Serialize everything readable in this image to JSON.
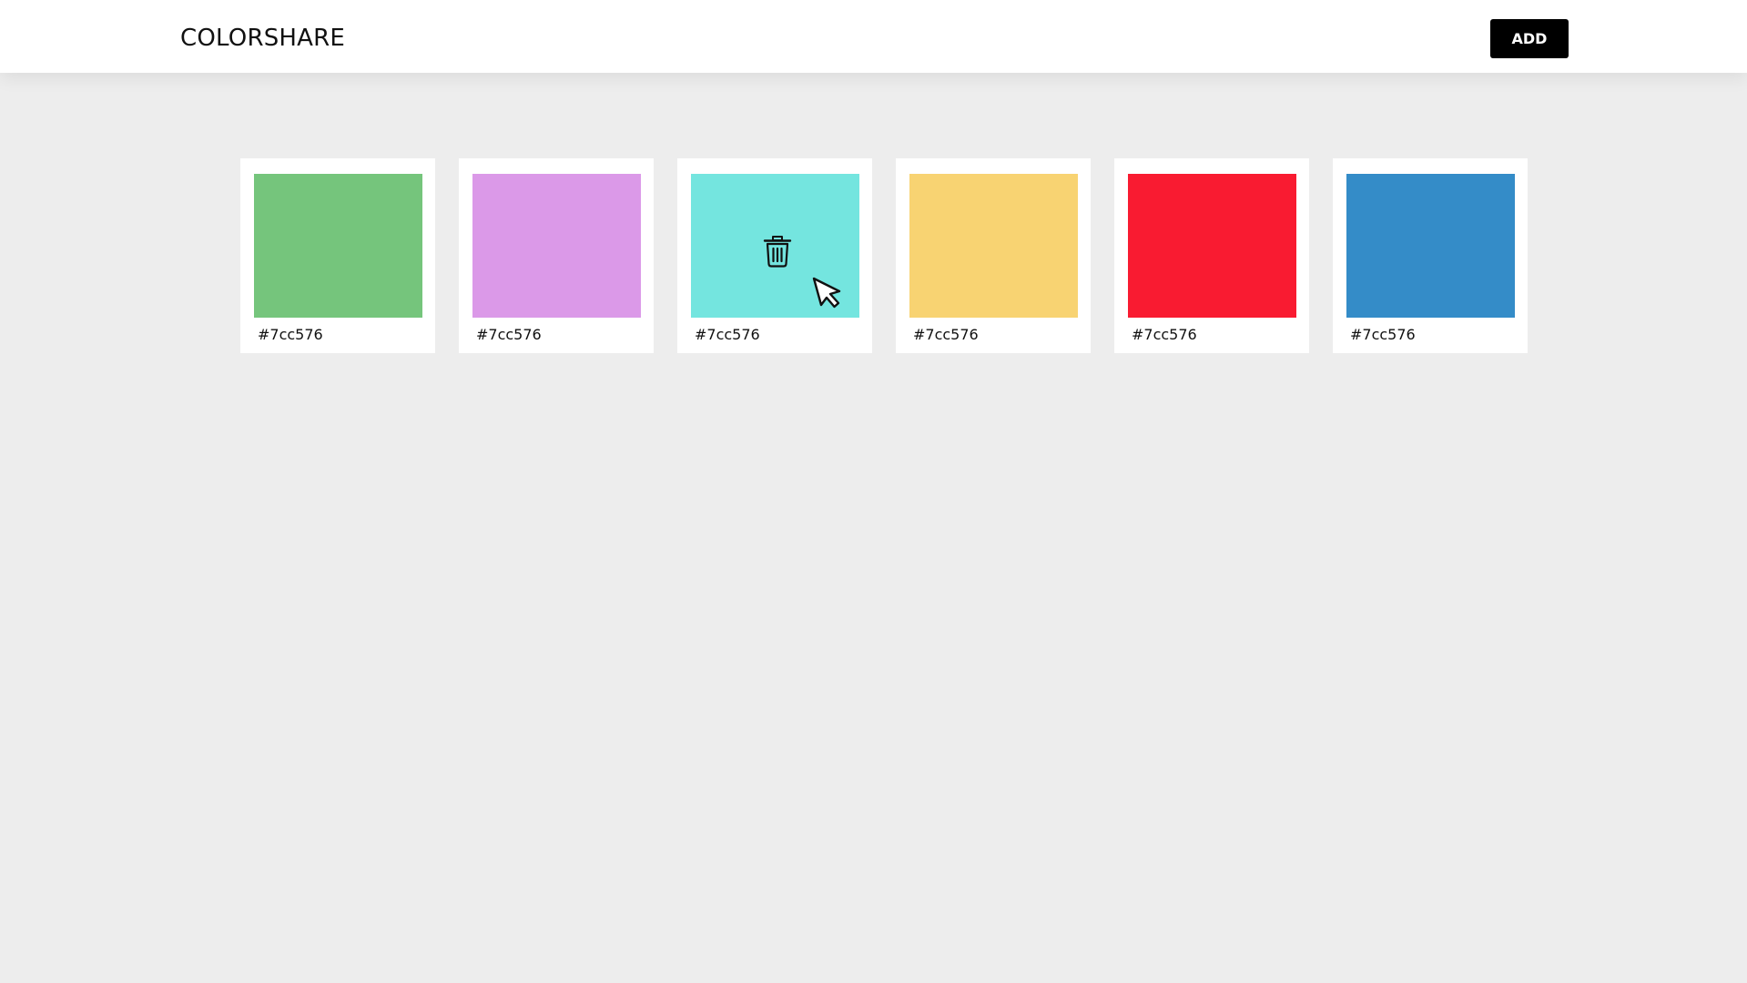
{
  "header": {
    "brand": "COLORSHARE",
    "add_label": "ADD"
  },
  "colors": [
    {
      "hex_label": "#7cc576",
      "swatch_color": "#75c57c"
    },
    {
      "hex_label": "#7cc576",
      "swatch_color": "#db99e8"
    },
    {
      "hex_label": "#7cc576",
      "swatch_color": "#74e5df",
      "hovered": true,
      "hover_icon": "trash-icon"
    },
    {
      "hex_label": "#7cc576",
      "swatch_color": "#f8d372"
    },
    {
      "hex_label": "#7cc576",
      "swatch_color": "#f91b31"
    },
    {
      "hex_label": "#7cc576",
      "swatch_color": "#348cc8"
    }
  ],
  "theme": {
    "background": "#ededed",
    "header_background": "#ffffff",
    "button_background": "#000000",
    "button_text": "#ffffff"
  }
}
